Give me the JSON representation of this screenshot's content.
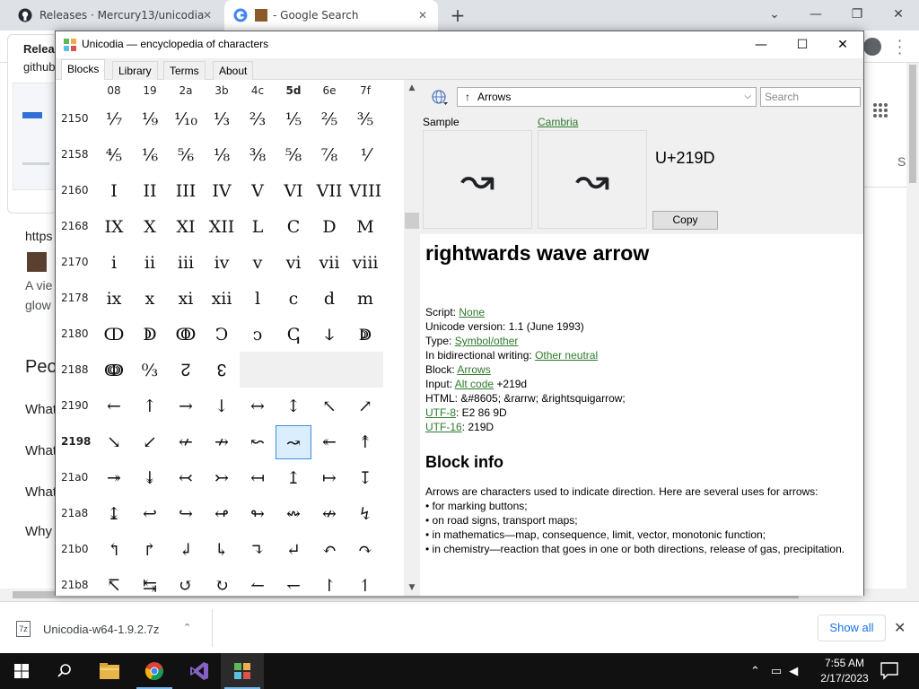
{
  "browser": {
    "tabs": [
      {
        "title": "Releases · Mercury13/unicodia",
        "icon": "github-icon"
      },
      {
        "title": "- Google Search",
        "icon": "google-icon"
      }
    ],
    "background_texts": {
      "releases_title": "Releas",
      "github_link": "github",
      "url_fragment": "https",
      "desc_line1": "A vie",
      "desc_line2": "glow",
      "people_heading": "Peo",
      "q1": "What",
      "q2": "What",
      "q3": "What",
      "q4": "Why",
      "side_letter": "S"
    }
  },
  "downloads": {
    "file_name": "Unicodia-w64-1.9.2.7z",
    "show_all": "Show all"
  },
  "taskbar": {
    "time": "7:55 AM",
    "date": "2/17/2023"
  },
  "app": {
    "title": "Unicodia — encyclopedia of characters",
    "tabs": [
      "Blocks",
      "Library",
      "Terms",
      "About"
    ],
    "grid": {
      "columns": [
        "08",
        "19",
        "2a",
        "3b",
        "4c",
        "5d",
        "6e",
        "7f"
      ],
      "rows": [
        {
          "label": "2150",
          "chars": [
            "⅐",
            "⅑",
            "⅒",
            "⅓",
            "⅔",
            "⅕",
            "⅖",
            "⅗"
          ]
        },
        {
          "label": "2158",
          "chars": [
            "⅘",
            "⅙",
            "⅚",
            "⅛",
            "⅜",
            "⅝",
            "⅞",
            "⅟"
          ]
        },
        {
          "label": "2160",
          "chars": [
            "I",
            "II",
            "III",
            "IV",
            "V",
            "VI",
            "VII",
            "VIII"
          ]
        },
        {
          "label": "2168",
          "chars": [
            "IX",
            "X",
            "XI",
            "XII",
            "L",
            "C",
            "D",
            "M"
          ]
        },
        {
          "label": "2170",
          "chars": [
            "i",
            "ii",
            "iii",
            "iv",
            "v",
            "vi",
            "vii",
            "viii"
          ]
        },
        {
          "label": "2178",
          "chars": [
            "ix",
            "x",
            "xi",
            "xii",
            "l",
            "c",
            "d",
            "m"
          ]
        },
        {
          "label": "2180",
          "chars": [
            "ↀ",
            "ↁ",
            "ↂ",
            "Ↄ",
            "ↄ",
            "ↅ",
            "ↆ",
            "ↇ"
          ]
        },
        {
          "label": "2188",
          "chars": [
            "ↈ",
            "↉",
            "↊",
            "↋",
            "",
            "",
            "",
            ""
          ]
        },
        {
          "label": "2190",
          "chars": [
            "←",
            "↑",
            "→",
            "↓",
            "↔",
            "↕",
            "↖",
            "↗"
          ]
        },
        {
          "label": "2198",
          "chars": [
            "↘",
            "↙",
            "↚",
            "↛",
            "↜",
            "↝",
            "↞",
            "↟"
          ]
        },
        {
          "label": "21a0",
          "chars": [
            "↠",
            "↡",
            "↢",
            "↣",
            "↤",
            "↥",
            "↦",
            "↧"
          ]
        },
        {
          "label": "21a8",
          "chars": [
            "↨",
            "↩",
            "↪",
            "↫",
            "↬",
            "↭",
            "↮",
            "↯"
          ]
        },
        {
          "label": "21b0",
          "chars": [
            "↰",
            "↱",
            "↲",
            "↳",
            "↴",
            "↵",
            "↶",
            "↷"
          ]
        },
        {
          "label": "21b8",
          "chars": [
            "↸",
            "↹",
            "↺",
            "↻",
            "↼",
            "↽",
            "↾",
            "↿"
          ]
        }
      ],
      "selected_row": "2198",
      "selected_column": "5d"
    },
    "block_select": {
      "glyph": "↑",
      "value": "Arrows"
    },
    "search_placeholder": "Search",
    "sample_label": "Sample",
    "font_label": "Cambria",
    "sample_glyph": "↝",
    "codepoint": "U+219D",
    "copy_label": "Copy",
    "char_name": "rightwards wave arrow",
    "info": {
      "script_label": "Script:",
      "script_value": "None",
      "version_label": "Unicode version:",
      "version_value": "1.1 (June 1993)",
      "type_label": "Type:",
      "type_value": "Symbol/other",
      "bidi_label": "In bidirectional writing:",
      "bidi_value": "Other neutral",
      "block_label": "Block:",
      "block_value": "Arrows",
      "input_label": "Input:",
      "input_link": "Alt code",
      "input_value": "+219d",
      "html_label": "HTML:",
      "html_value": "&#8605; &rarrw; &rightsquigarrow;",
      "utf8_label": "UTF-8",
      "utf8_value": ": E2 86 9D",
      "utf16_label": "UTF-16",
      "utf16_value": ": 219D"
    },
    "block_info_title": "Block info",
    "block_info_lines": [
      "Arrows are characters used to indicate direction. Here are several uses for arrows:",
      "• for marking buttons;",
      "• on road signs, transport maps;",
      "• in mathematics—map, consequence, limit, vector, monotonic function;",
      "• in chemistry—reaction that goes in one or both directions, release of gas, precipitation."
    ]
  }
}
